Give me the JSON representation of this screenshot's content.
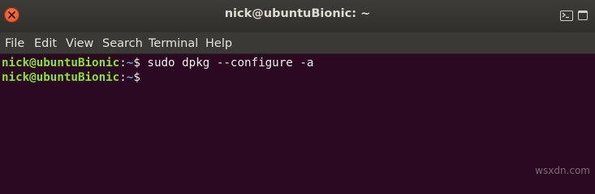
{
  "window": {
    "title": "nick@ubuntuBionic: ~"
  },
  "menu": {
    "items": [
      "File",
      "Edit",
      "View",
      "Search",
      "Terminal",
      "Help"
    ]
  },
  "terminal": {
    "lines": [
      {
        "user": "nick@ubuntuBionic",
        "colon": ":",
        "path": "~",
        "prompt": "$",
        "command": " sudo dpkg --configure -a"
      },
      {
        "user": "nick@ubuntuBionic",
        "colon": ":",
        "path": "~",
        "prompt": "$",
        "command": ""
      }
    ]
  },
  "watermark": "wsxdn.com",
  "colors": {
    "background": "#2c0922",
    "user": "#8ae234",
    "path": "#729fcf",
    "close_button": "#e95420"
  }
}
